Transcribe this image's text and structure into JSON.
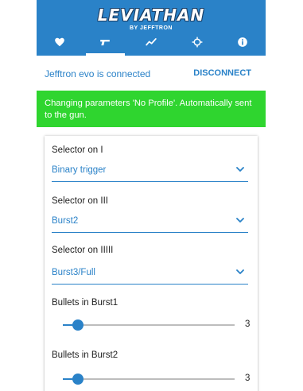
{
  "header": {
    "logo_title": "LEVIATHAN",
    "logo_subtitle": "BY JEFFTRON",
    "background": "#2a82c8",
    "tabs": [
      {
        "icon": "heart-icon",
        "active": false
      },
      {
        "icon": "gun-icon",
        "active": true
      },
      {
        "icon": "chart-line-icon",
        "active": false
      },
      {
        "icon": "crosshair-icon",
        "active": false
      },
      {
        "icon": "info-icon",
        "active": false
      }
    ]
  },
  "connection": {
    "status_text": "Jefftron evo is connected",
    "disconnect_label": "DISCONNECT"
  },
  "banner": {
    "text": "Changing parameters 'No Profile'. Automatically sent to the gun.",
    "color": "#2fd52f"
  },
  "settings": {
    "selectors": [
      {
        "label": "Selector on I",
        "value": "Binary trigger"
      },
      {
        "label": "Selector on III",
        "value": "Burst2"
      },
      {
        "label": "Selector on IIIII",
        "value": "Burst3/Full"
      }
    ],
    "sliders": [
      {
        "label": "Bullets in Burst1",
        "value": "3",
        "fraction": 0.09
      },
      {
        "label": "Bullets in Burst2",
        "value": "3",
        "fraction": 0.09
      }
    ]
  },
  "colors": {
    "accent": "#2a82c8",
    "success": "#2fd52f"
  }
}
